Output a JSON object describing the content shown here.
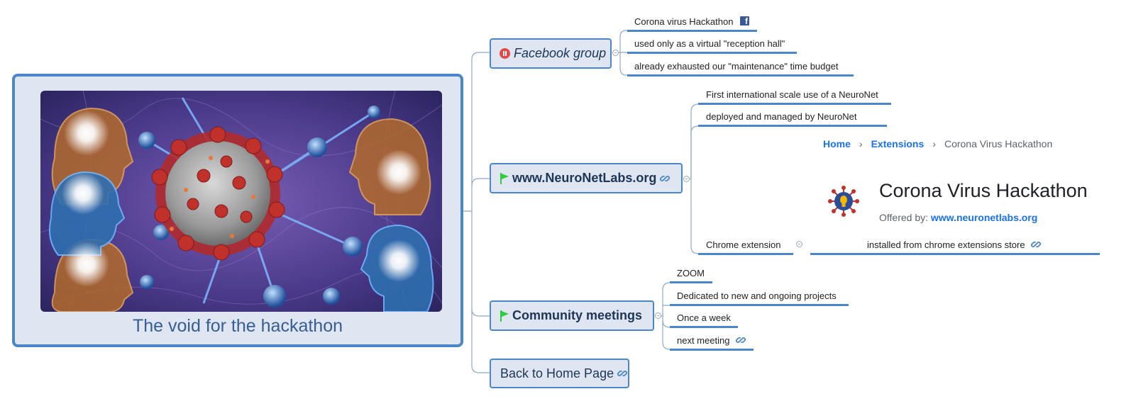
{
  "central": {
    "title": "The void for the hackathon",
    "image": "coronavirus-network-illustration"
  },
  "topics": [
    {
      "label": "Facebook group",
      "icon": "pause-icon",
      "children": [
        {
          "text": "Corona virus Hackathon",
          "icon": "facebook-icon"
        },
        {
          "text": "used only as a virtual \"reception hall\""
        },
        {
          "text": "already exhausted our \"maintenance\" time budget"
        }
      ]
    },
    {
      "label": "www.NeuroNetLabs.org",
      "icon": "flag-icon",
      "link": true,
      "children": [
        {
          "text": "First international scale use of a NeuroNet"
        },
        {
          "text": "deployed and managed by NeuroNet"
        },
        {
          "text": "Chrome extension",
          "children": [
            {
              "text": "installed from chrome extensions store",
              "link": true
            }
          ]
        }
      ]
    },
    {
      "label": "Community meetings",
      "icon": "flag-icon",
      "children": [
        {
          "text": "ZOOM"
        },
        {
          "text": "Dedicated to new and ongoing projects"
        },
        {
          "text": "Once a week"
        },
        {
          "text": "next meeting",
          "link": true
        }
      ]
    },
    {
      "label": "Back to Home Page",
      "link": true
    }
  ],
  "extension_page": {
    "breadcrumb": [
      "Home",
      "Extensions",
      "Corona Virus Hackathon"
    ],
    "title": "Corona Virus Hackathon",
    "offered_by_label": "Offered by:",
    "offered_by_link": "www.neuronetlabs.org"
  },
  "colors": {
    "topic_border": "#4a86c8",
    "topic_fill": "#dfe6f1",
    "title_text": "#355e95",
    "flag": "#2ecc40",
    "pause": "#e24a4a",
    "link_blue": "#1a73e8"
  }
}
